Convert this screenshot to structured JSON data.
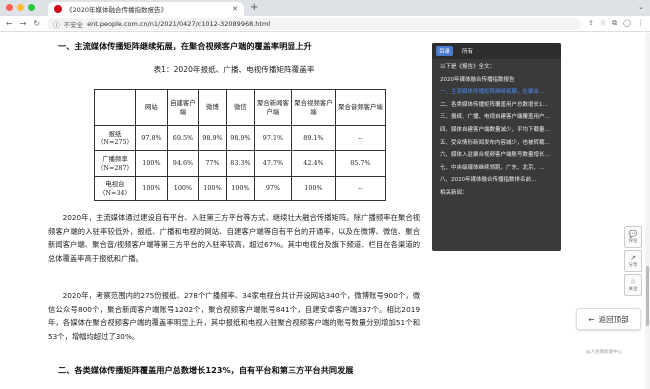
{
  "browser": {
    "tab_title": "《2020年媒体融合传播指数报告》",
    "url": "ent.people.com.cn/n1/2021/0427/c1012-32089968.html",
    "insecure_label": "不安全"
  },
  "article": {
    "heading1": "一、主流媒体传播矩阵继续拓展，在聚合视频客户端的覆盖率明显上升",
    "table_caption": "表1：2020年报纸、广播、电视传播矩阵覆盖率",
    "table": {
      "headers": [
        "",
        "网站",
        "自建客户端",
        "微博",
        "微信",
        "聚合新闻客户端",
        "聚合视频客户端",
        "聚合音频客户端"
      ],
      "rows": [
        [
          "报纸（N=275）",
          "97.8%",
          "69.5%",
          "98.9%",
          "98.9%",
          "97.1%",
          "89.1%",
          "--"
        ],
        [
          "广播频率（N=287）",
          "100%",
          "94.6%",
          "77%",
          "83.3%",
          "47.7%",
          "42.4%",
          "85.7%"
        ],
        [
          "电视台（N=34）",
          "100%",
          "100%",
          "100%",
          "100%",
          "97%",
          "100%",
          "--"
        ]
      ]
    },
    "para1": "2020年，主流媒体通过建设自有平台、入驻第三方平台等方式，继续壮大融合传播矩阵。除广播频率在聚合视频客户端的入驻率较低外，报纸、广播和电视的网站、自建客户端等自有平台的开通率，以及在微博、微信、聚合新闻客户端、聚合音/视频客户端等第三方平台的入驻率较高，超过67%。其中电视台及旗下频道、栏目在各渠道的总体覆盖率高于报纸和广播。",
    "para2": "2020年，考察范围内的275份报纸、278个广播频率、34家电视台共计开设网站340个，微博账号900个，微信公众号800个，聚合新闻客户端账号1202个，聚合视频客户端账号841个，自建安卓客户端337个。相比2019年，各媒体在聚合视频客户端的覆盖率明显上升，其中报纸和电视入驻聚合视频客户端的账号数量分别增加51个和53个，增幅均超过了30%。",
    "heading2": "二、各类媒体传播矩阵覆盖用户总数增长123%，自有平台和第三方平台共同发展"
  },
  "outline_panel": {
    "tabs": [
      "目录",
      "所有"
    ],
    "items": [
      "以下是《报告》全文：",
      "2020年媒体融合传播指数报告",
      "一、主流媒体传播矩阵继续拓展，在聚合…",
      "二、各类媒体传播矩阵覆盖用户总数增长1…",
      "三、报纸、广播、电视自建客户端覆盖用户…",
      "四、媒体自建客户端数量减少，平均下载量…",
      "五、受众情形新闻发布内容减少，也被转载…",
      "六、媒体入驻聚合视频客户端账号数量增长…",
      "七、中央级媒体继续领跑，广东、北京、…",
      "八、2020年媒体融合传播指数排名前…",
      "相关新闻："
    ],
    "highlight_index": 2
  },
  "side_tools": [
    {
      "icon": "comment-icon",
      "glyph": "💬",
      "label": "评论"
    },
    {
      "icon": "share-icon",
      "glyph": "↗",
      "label": "分享"
    },
    {
      "icon": "follow-icon",
      "glyph": "☆",
      "label": "关注"
    }
  ],
  "back_to_top": "返回顶部",
  "watermark": "@人民网新闻中心",
  "colors": {
    "accent": "#4b8cf7",
    "panel_bg": "#3a3a3a",
    "brand_red": "#d0021b"
  }
}
